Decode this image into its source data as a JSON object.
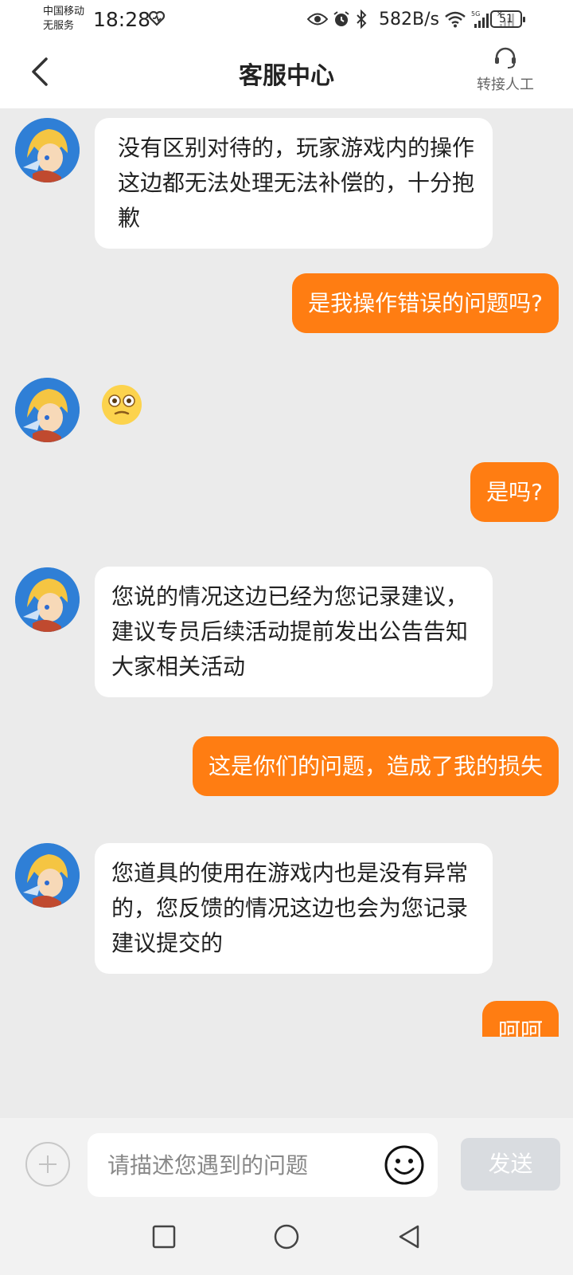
{
  "status_bar": {
    "carrier_line1": "中国移动",
    "carrier_line2": "无服务",
    "time": "18:28",
    "net_speed": "582B/s",
    "battery": "51"
  },
  "header": {
    "title": "客服中心",
    "agent_label": "转接人工"
  },
  "messages": [
    {
      "from": "agent",
      "text": "没有区别对待的，玩家游戏内的操作这边都无法处理无法补偿的，十分抱歉"
    },
    {
      "from": "user",
      "text": "是我操作错误的问题吗?"
    },
    {
      "from": "agent",
      "type": "emoji",
      "icon": "flushed-face-emoji"
    },
    {
      "from": "user",
      "text": "是吗?"
    },
    {
      "from": "agent",
      "text": "您说的情况这边已经为您记录建议，建议专员后续活动提前发出公告告知大家相关活动"
    },
    {
      "from": "user",
      "text": "这是你们的问题，造成了我的损失"
    },
    {
      "from": "agent",
      "text": "您道具的使用在游戏内也是没有异常的，您反馈的情况这边也会为您记录建议提交的"
    },
    {
      "from": "user",
      "text": "呵呵"
    }
  ],
  "input": {
    "placeholder": "请描述您遇到的问题",
    "send_label": "发送"
  },
  "colors": {
    "accent": "#ff7d12",
    "background": "#ebebeb",
    "send_disabled": "#d9dce0"
  }
}
